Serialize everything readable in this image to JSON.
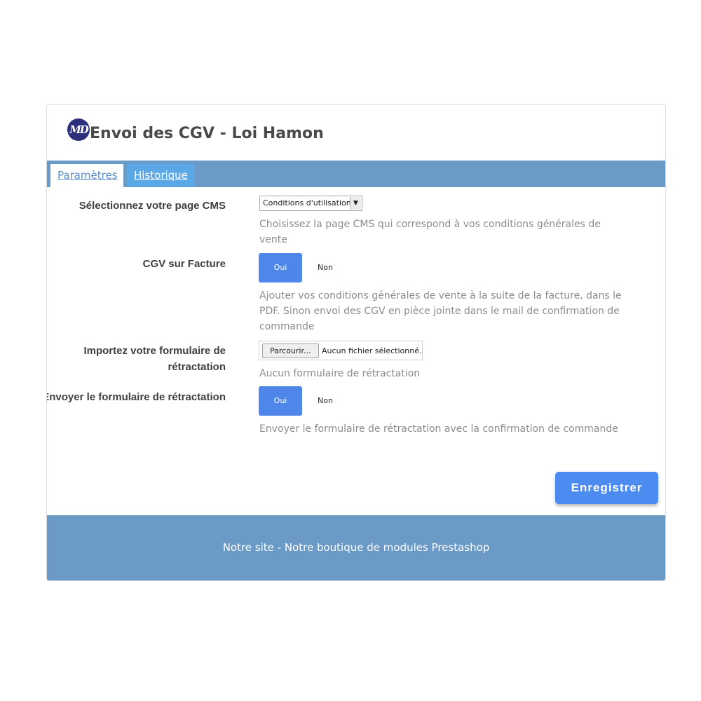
{
  "header": {
    "logo_text": "MD",
    "title": "Envoi des CGV - Loi Hamon"
  },
  "tabs": [
    {
      "label": "Paramètres",
      "active": true
    },
    {
      "label": "Historique",
      "active": false
    }
  ],
  "form": {
    "cms_page": {
      "label": "Sélectionnez votre page CMS",
      "selected": "Conditions d'utilisation",
      "help": "Choisissez la page CMS qui correspond à vos conditions générales de vente"
    },
    "cgv_invoice": {
      "label": "CGV sur Facture",
      "yes": "Oui",
      "no": "Non",
      "value": "Oui",
      "help": "Ajouter vos conditions générales de vente à la suite de la facture, dans le PDF. Sinon envoi des CGV en pièce jointe dans le mail de confirmation de commande"
    },
    "withdrawal_form": {
      "label_line1": "Importez votre formulaire de",
      "label_line2": "rétractation",
      "browse": "Parcourir...",
      "file_status": "Aucun fichier sélectionné.",
      "help": "Aucun formulaire de rétractation"
    },
    "send_withdrawal": {
      "label": "Envoyer le formulaire de rétractation",
      "yes": "Oui",
      "no": "Non",
      "value": "Oui",
      "help": "Envoyer le formulaire de rétractation avec la confirmation de commande"
    },
    "save_label": "Enregistrer"
  },
  "footer": {
    "text": "Notre site - Notre boutique de modules Prestashop"
  },
  "colors": {
    "tab_bar": "#6b9ac6",
    "tab_inactive": "#5aa8e6",
    "button_blue": "#4c8bef",
    "logo": "#2c2f7a"
  }
}
